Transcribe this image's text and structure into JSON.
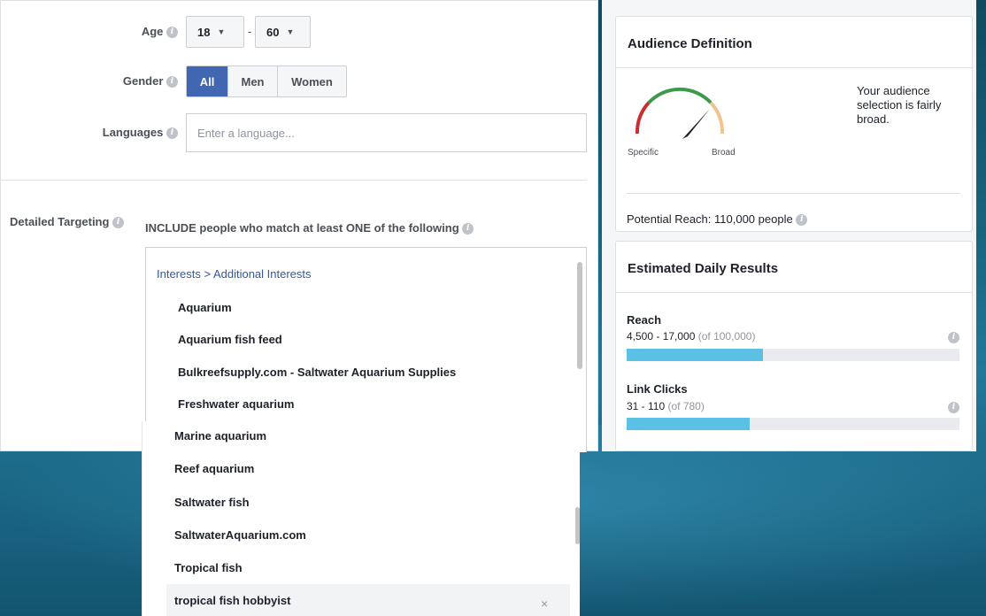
{
  "targeting": {
    "age": {
      "label": "Age",
      "min": "18",
      "max": "60",
      "separator": "-"
    },
    "gender": {
      "label": "Gender",
      "options": [
        "All",
        "Men",
        "Women"
      ],
      "selected": "All"
    },
    "languages": {
      "label": "Languages",
      "placeholder": "Enter a language..."
    },
    "detailed": {
      "label": "Detailed Targeting",
      "include_text": "INCLUDE people who match at least ONE of the following",
      "breadcrumb": "Interests > Additional Interests",
      "items": [
        "Aquarium",
        "Aquarium fish feed",
        "Bulkreefsupply.com - Saltwater Aquarium Supplies",
        "Freshwater aquarium"
      ],
      "overflow_items": [
        "Marine aquarium",
        "Reef aquarium",
        "Saltwater fish",
        "SaltwaterAquarium.com",
        "Tropical fish",
        "tropical fish hobbyist"
      ],
      "remove_label": "×"
    }
  },
  "audience": {
    "title": "Audience Definition",
    "gauge_low": "Specific",
    "gauge_high": "Broad",
    "description": "Your audience selection is fairly broad.",
    "potential_reach": "Potential Reach: 110,000 people"
  },
  "estimated": {
    "title": "Estimated Daily Results",
    "metrics": [
      {
        "label": "Reach",
        "range": "4,500 - 17,000",
        "total": "(of 100,000)",
        "fill": 0.41
      },
      {
        "label": "Link Clicks",
        "range": "31 - 110",
        "total": "(of 780)",
        "fill": 0.37
      }
    ]
  },
  "colors": {
    "accent": "#4267b2",
    "bar": "#5bc0e4",
    "link": "#365899"
  },
  "icons": {
    "info": "info-icon",
    "close": "close-icon",
    "caret": "caret-down-icon"
  }
}
